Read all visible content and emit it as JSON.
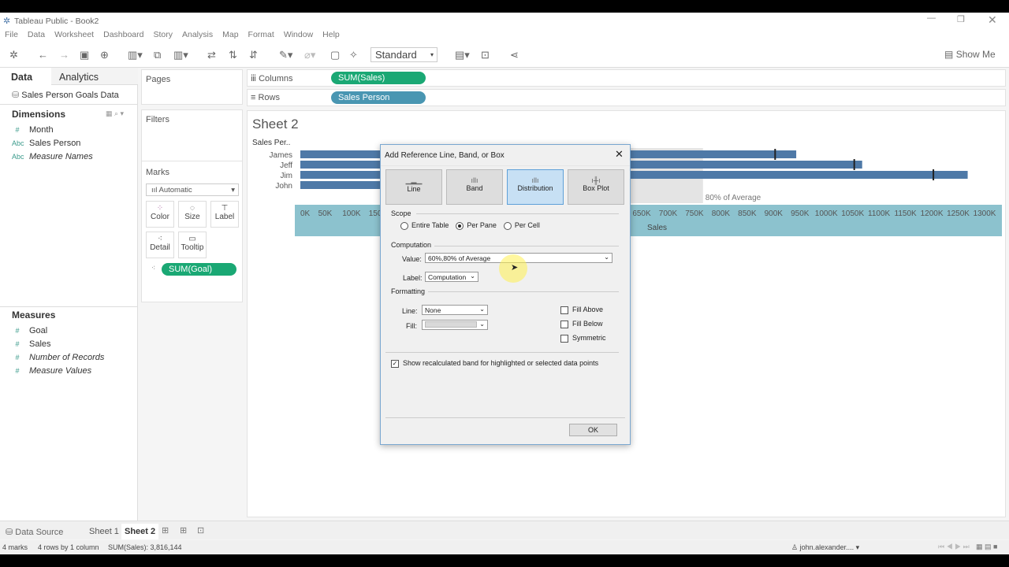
{
  "window": {
    "title": "Tableau Public - Book2"
  },
  "menu": [
    "File",
    "Data",
    "Worksheet",
    "Dashboard",
    "Story",
    "Analysis",
    "Map",
    "Format",
    "Window",
    "Help"
  ],
  "toolbar": {
    "fit": "Standard",
    "show_me": "Show Me"
  },
  "left": {
    "tabs": {
      "data": "Data",
      "analytics": "Analytics"
    },
    "source": "Sales Person Goals Data",
    "dimensions_title": "Dimensions",
    "dimensions": [
      {
        "type": "#",
        "label": "Month"
      },
      {
        "type": "Abc",
        "label": "Sales Person"
      },
      {
        "type": "Abc",
        "label": "Measure Names"
      }
    ],
    "measures_title": "Measures",
    "measures": [
      {
        "label": "Goal"
      },
      {
        "label": "Sales"
      },
      {
        "label": "Number of Records"
      },
      {
        "label": "Measure Values"
      }
    ]
  },
  "cards": {
    "pages": "Pages",
    "filters": "Filters",
    "marks": "Marks",
    "mark_type": "Automatic",
    "buttons": [
      "Color",
      "Size",
      "Label",
      "Detail",
      "Tooltip"
    ],
    "pill": "SUM(Goal)"
  },
  "shelves": {
    "columns_label": "Columns",
    "columns_pill": "SUM(Sales)",
    "rows_label": "Rows",
    "rows_pill": "Sales Person"
  },
  "sheet": {
    "title": "Sheet 2",
    "row_header": "Sales Per.."
  },
  "chart_data": {
    "type": "bar",
    "orientation": "horizontal",
    "xlabel": "Sales",
    "categories": [
      "James",
      "Jeff",
      "Jim",
      "John"
    ],
    "series": [
      {
        "name": "SUM(Sales)",
        "values": [
          940000,
          1065000,
          1265000,
          546144
        ]
      },
      {
        "name": "SUM(Goal)",
        "values": [
          900000,
          1050000,
          1200000,
          null
        ]
      }
    ],
    "xlim": [
      0,
      1300000
    ],
    "xticks": [
      "0K",
      "50K",
      "100K",
      "150K",
      "200K",
      "250K",
      "300K",
      "350K",
      "400K",
      "450K",
      "500K",
      "550K",
      "600K",
      "650K",
      "700K",
      "750K",
      "800K",
      "850K",
      "900K",
      "950K",
      "1000K",
      "1050K",
      "1100K",
      "1150K",
      "1200K",
      "1250K",
      "1300K"
    ],
    "band": {
      "from_pct": 60,
      "to_pct": 80,
      "of": "Average",
      "labels": [
        "Average",
        "80% of Average"
      ]
    },
    "colors": {
      "bar": "#4e79a7",
      "goal": "#222222",
      "band": "#d9d9d9",
      "axis": "#8cc2ce"
    }
  },
  "dialog": {
    "title": "Add Reference Line, Band, or Box",
    "types": [
      "Line",
      "Band",
      "Distribution",
      "Box Plot"
    ],
    "selected": "Distribution",
    "scope_title": "Scope",
    "scope": [
      "Entire Table",
      "Per Pane",
      "Per Cell"
    ],
    "scope_selected": "Per Pane",
    "computation_title": "Computation",
    "value_label": "Value:",
    "value": "60%,80% of Average",
    "label_label": "Label:",
    "label_value": "Computation",
    "formatting_title": "Formatting",
    "line_label": "Line:",
    "line_value": "None",
    "fill_label": "Fill:",
    "checks": [
      {
        "label": "Fill Above",
        "checked": false
      },
      {
        "label": "Fill Below",
        "checked": false
      },
      {
        "label": "Symmetric",
        "checked": false
      }
    ],
    "recalc": "Show recalculated band for highlighted or selected data points",
    "ok": "OK"
  },
  "tabs": {
    "data_source": "Data Source",
    "sheets": [
      "Sheet 1",
      "Sheet 2"
    ],
    "active": "Sheet 2"
  },
  "status": {
    "marks": "4 marks",
    "rows": "4 rows by 1 column",
    "sum": "SUM(Sales): 3,816,144",
    "user": "john.alexander...."
  }
}
